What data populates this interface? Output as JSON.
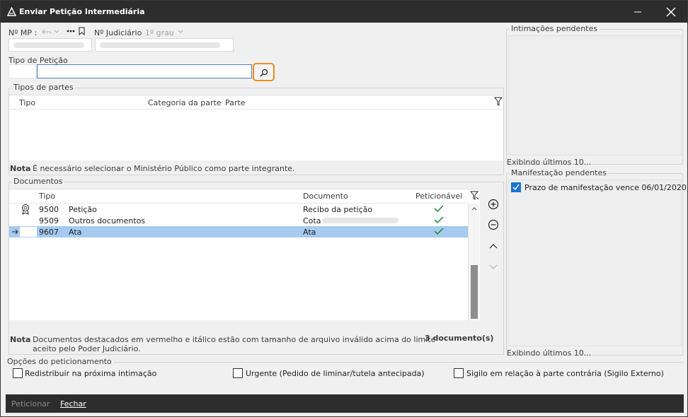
{
  "window": {
    "title": "Enviar Petição Intermediária",
    "accent": "#f08c1e",
    "selection": "#a6caf0",
    "check_color": "#1a8a2a",
    "checkbox_blue": "#1874d2"
  },
  "header": {
    "mp_label": "Nº MP :",
    "judiciario_label": "Nº Judiciário",
    "grau_value": "1º grau"
  },
  "peticao": {
    "tipo_label": "Tipo de Petição",
    "search_value": ""
  },
  "partes": {
    "group_title": "Tipos de partes",
    "columns": [
      "Tipo",
      "Categoria da parte",
      "Parte"
    ],
    "nota_label": "Nota",
    "nota_text": "É necessário selecionar o Ministério Público como parte integrante."
  },
  "documentos": {
    "group_title": "Documentos",
    "columns": {
      "tipo": "Tipo",
      "documento": "Documento",
      "peticionavel": "Peticionável"
    },
    "rows": [
      {
        "codigo": "9500",
        "descricao": "Petição",
        "documento": "Recibo da petição",
        "peticionavel": true,
        "selected": false
      },
      {
        "codigo": "9509",
        "descricao": "Outros documentos",
        "documento": "Cota",
        "peticionavel": true,
        "selected": false
      },
      {
        "codigo": "9607",
        "descricao": "Ata",
        "documento": "Ata",
        "peticionavel": true,
        "selected": true
      }
    ],
    "nota_label": "Nota",
    "nota_line1": "Documentos destacados em vermelho e itálico estão com tamanho de arquivo inválido acima do limite",
    "nota_line2": "aceito pelo Poder Judiciário.",
    "count": "3 documento(s)"
  },
  "intimacoes": {
    "group_title": "Intimações pendentes",
    "footer": "Exibindo últimos 10..."
  },
  "manifestacao": {
    "group_title": "Manifestação pendentes",
    "item": "Prazo de manifestação vence 06/01/2020",
    "item_checked": true,
    "footer": "Exibindo últimos 10..."
  },
  "opcoes": {
    "group_title": "Opções do peticionamento",
    "redistribuir": "Redistribuir na próxima intimação",
    "urgente": "Urgente (Pedido de liminar/tutela antecipada)",
    "sigilo": "Sigilo em relação à parte contrária (Sigilo Externo)"
  },
  "footer": {
    "peticionar": "Peticionar",
    "fechar": "Fechar"
  }
}
